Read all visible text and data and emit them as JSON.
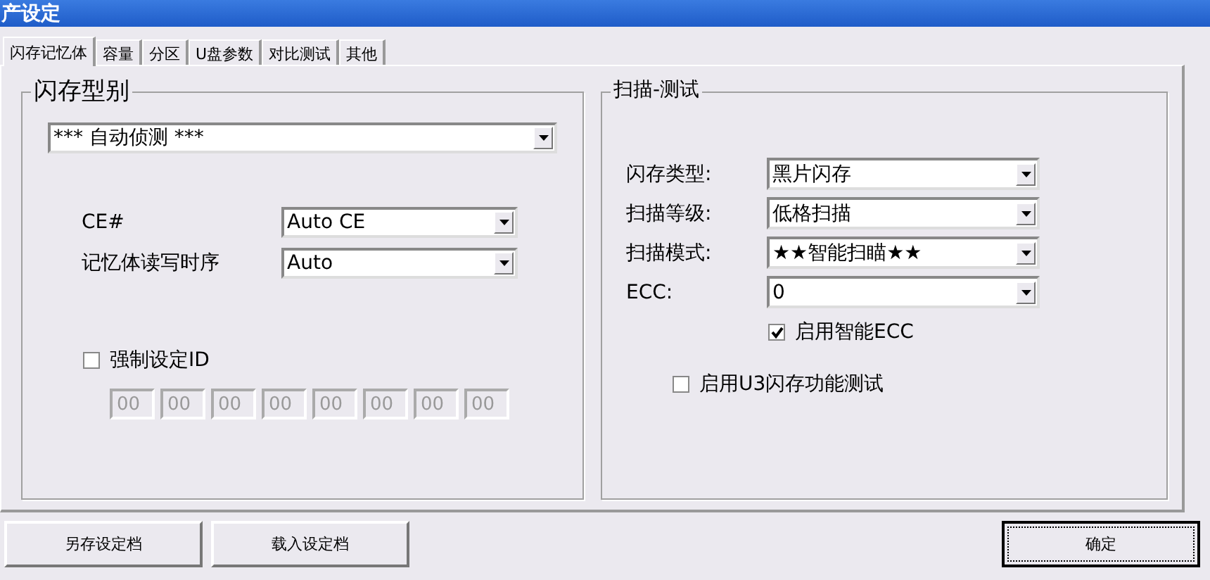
{
  "window": {
    "title": "产设定"
  },
  "tabs": [
    {
      "label": "闪存记忆体",
      "selected": true
    },
    {
      "label": "容量",
      "selected": false
    },
    {
      "label": "分区",
      "selected": false
    },
    {
      "label": "U盘参数",
      "selected": false
    },
    {
      "label": "对比测试",
      "selected": false
    },
    {
      "label": "其他",
      "selected": false
    }
  ],
  "flash_group": {
    "title": "闪存型别",
    "model": "*** 自动侦测 ***",
    "ce_label": "CE#",
    "ce_value": "Auto CE",
    "timing_label": "记忆体读写时序",
    "timing_value": "Auto",
    "force_id": {
      "label": "强制设定ID",
      "checked": false
    },
    "id_bytes": [
      "00",
      "00",
      "00",
      "00",
      "00",
      "00",
      "00",
      "00"
    ]
  },
  "scan_group": {
    "title": "扫描-测试",
    "fields": [
      {
        "label": "闪存类型:",
        "value": "黑片闪存"
      },
      {
        "label": "扫描等级:",
        "value": "低格扫描"
      },
      {
        "label": "扫描模式:",
        "value": "★★智能扫瞄★★"
      },
      {
        "label": "ECC:",
        "value": "0"
      }
    ],
    "smart_ecc": {
      "label": "启用智能ECC",
      "checked": true
    },
    "u3_test": {
      "label": "启用U3闪存功能测试",
      "checked": false
    }
  },
  "buttons": [
    {
      "label": "另存设定档",
      "default": false
    },
    {
      "label": "载入设定档",
      "default": false
    },
    {
      "label": "确定",
      "default": true
    }
  ]
}
